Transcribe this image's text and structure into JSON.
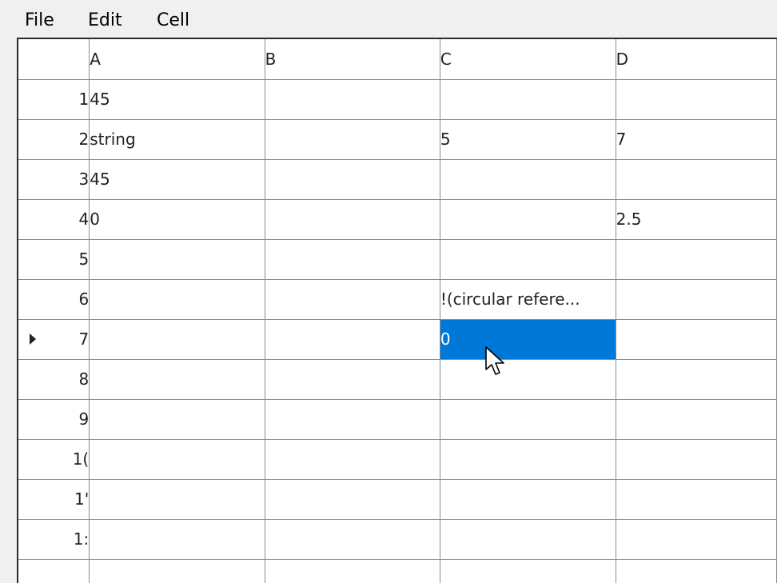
{
  "menu": {
    "file": "File",
    "edit": "Edit",
    "cell": "Cell"
  },
  "grid": {
    "columns": [
      "A",
      "B",
      "C",
      "D"
    ],
    "rows": [
      {
        "header": "1",
        "cells": [
          "45",
          "",
          "",
          ""
        ]
      },
      {
        "header": "2",
        "cells": [
          "string",
          "",
          "5",
          "7"
        ]
      },
      {
        "header": "3",
        "cells": [
          "45",
          "",
          "",
          ""
        ]
      },
      {
        "header": "4",
        "cells": [
          "0",
          "",
          "",
          "2.5"
        ]
      },
      {
        "header": "5",
        "cells": [
          "",
          "",
          "",
          ""
        ]
      },
      {
        "header": "6",
        "cells": [
          "",
          "",
          "!(circular refere...",
          ""
        ]
      },
      {
        "header": "7",
        "cells": [
          "",
          "",
          "0",
          ""
        ]
      },
      {
        "header": "8",
        "cells": [
          "",
          "",
          "",
          ""
        ]
      },
      {
        "header": "9",
        "cells": [
          "",
          "",
          "",
          ""
        ]
      },
      {
        "header": "1(",
        "cells": [
          "",
          "",
          "",
          ""
        ]
      },
      {
        "header": "1'",
        "cells": [
          "",
          "",
          "",
          ""
        ]
      },
      {
        "header": "1:",
        "cells": [
          "",
          "",
          "",
          ""
        ]
      },
      {
        "header": "",
        "cells": [
          "",
          "",
          "",
          ""
        ]
      }
    ],
    "selected_cell": "C7",
    "current_row": "7"
  },
  "icons": {
    "row_indicator": "current-row-arrow-icon",
    "mouse_cursor": "mouse-pointer-icon"
  },
  "colors": {
    "selection": "#0078d7",
    "grid_line": "#8c8c8c",
    "background": "#f0f0f0"
  }
}
